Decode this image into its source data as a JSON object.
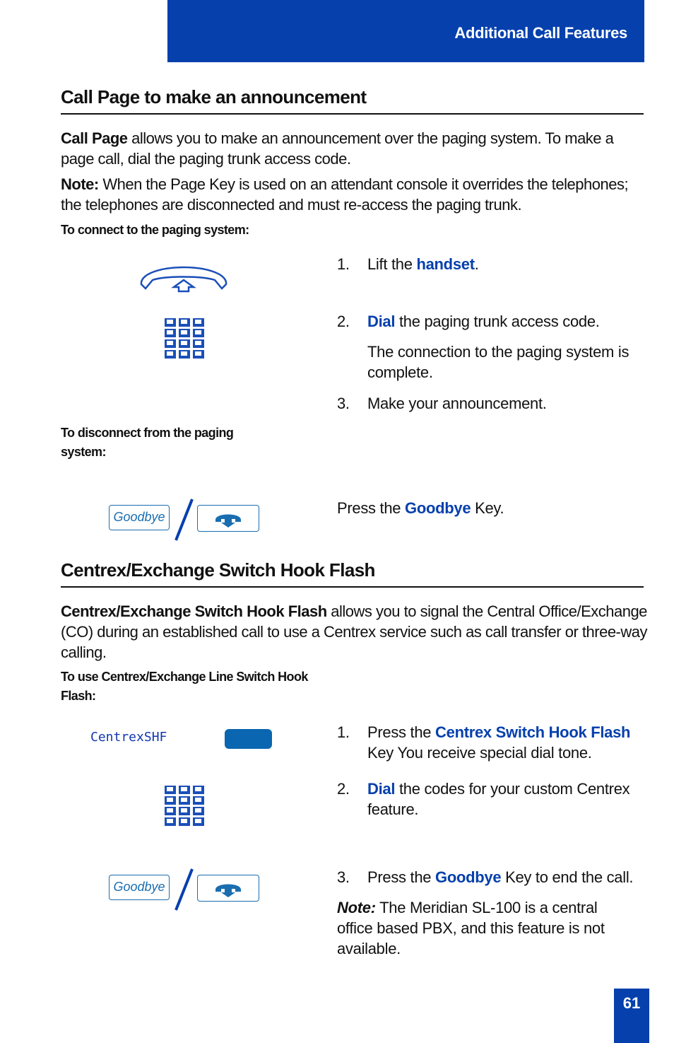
{
  "header": {
    "title": "Additional Call Features"
  },
  "section1": {
    "title": "Call Page to make an announcement",
    "intro_bold": "Call Page",
    "intro_rest": " allows you to make an announcement over the paging system. To make a page call, dial the paging trunk access code.",
    "note_bold": "Note:",
    "note_rest": " When the Page Key is used on an attendant console it overrides the telephones; the telephones are disconnected and must re-access the paging trunk.",
    "connect_heading": "To connect to the paging system:",
    "steps": [
      {
        "num": "1.",
        "pre": "Lift the ",
        "hl": "handset",
        "post": "."
      },
      {
        "num": "2.",
        "pre": "",
        "hl": "Dial",
        "post": " the paging trunk access code.",
        "extra": "The connection to the paging system is complete."
      },
      {
        "num": "3.",
        "pre": "Make your announcement.",
        "hl": "",
        "post": ""
      }
    ],
    "disconnect_heading": "To disconnect from the paging system:",
    "disconnect_step": {
      "pre": "Press the ",
      "hl": "Goodbye",
      "post": " Key."
    }
  },
  "section2": {
    "title": "Centrex/Exchange Switch Hook Flash",
    "intro_bold": "Centrex/Exchange Switch Hook Flash",
    "intro_rest": " allows you to signal the Central Office/Exchange (CO) during an established call to use a Centrex service such as call transfer or three-way calling.",
    "use_heading": "To use Centrex/Exchange Line Switch Hook Flash:",
    "lcd_label": "CentrexSHF",
    "steps": [
      {
        "num": "1.",
        "pre": "Press the ",
        "hl": "Centrex Switch Hook Flash",
        "post": " Key You receive special dial tone."
      },
      {
        "num": "2.",
        "pre": "",
        "hl": "Dial",
        "post": " the codes for your custom Centrex feature."
      },
      {
        "num": "3.",
        "pre": "Press the ",
        "hl": "Goodbye",
        "post": " Key to end the call."
      }
    ],
    "note_bold": "Note:",
    "note_rest": " The Meridian SL-100 is a central office based PBX, and this feature is not available."
  },
  "keys": {
    "goodbye_label": "Goodbye"
  },
  "icons": {
    "handset": "handset-lift-icon",
    "dialpad": "dialpad-icon",
    "hangup": "hangup-key-icon",
    "slash": "or-slash"
  },
  "colors": {
    "brand_blue": "#0540ad",
    "key_blue": "#1a6eb0"
  },
  "footer": {
    "page_number": "61"
  }
}
